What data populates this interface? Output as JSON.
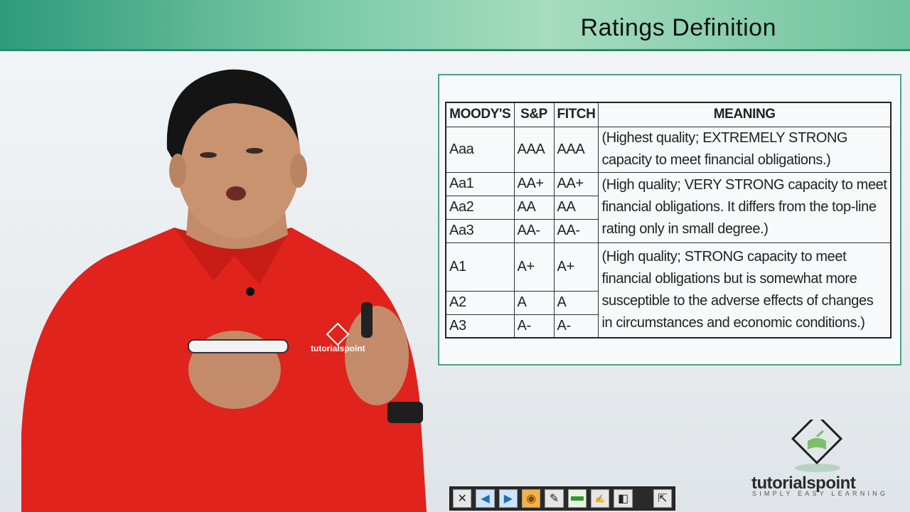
{
  "slide": {
    "title": "Ratings Definition"
  },
  "table": {
    "headers": [
      "MOODY'S",
      "S&P",
      "FITCH",
      "MEANING"
    ],
    "rows": [
      {
        "moody": "Aaa",
        "sp": "AAA",
        "fitch": "AAA"
      },
      {
        "moody": "Aa1",
        "sp": "AA+",
        "fitch": "AA+"
      },
      {
        "moody": "Aa2",
        "sp": "AA",
        "fitch": "AA"
      },
      {
        "moody": "Aa3",
        "sp": "AA-",
        "fitch": "AA-"
      },
      {
        "moody": "A1",
        "sp": "A+",
        "fitch": "A+"
      },
      {
        "moody": "A2",
        "sp": "A",
        "fitch": "A"
      },
      {
        "moody": "A3",
        "sp": "A-",
        "fitch": "A-"
      }
    ],
    "meanings": [
      "(Highest quality; EXTREMELY STRONG capacity to meet financial obligations.)",
      "(High quality; VERY STRONG capacity to meet financial obligations. It differs from the top-line rating only in small degree.)",
      "(High quality; STRONG capacity to meet financial obligations but is somewhat more susceptible to the adverse effects of changes in circumstances and economic conditions.)"
    ]
  },
  "logo": {
    "name": "tutorialspoint",
    "tagline": "SIMPLY EASY LEARNING"
  },
  "shirt_logo": "tutorialspoint",
  "toolbar": {
    "tools": [
      "close-icon",
      "arrow-left-icon",
      "arrow-right-icon",
      "mouse-icon",
      "pen-icon",
      "highlighter-icon",
      "text-icon",
      "shapes-icon",
      "exit-icon"
    ]
  },
  "colors": {
    "header_band": "#6fc39e",
    "frame_border": "#4aa583",
    "shirt": "#e0231c"
  }
}
